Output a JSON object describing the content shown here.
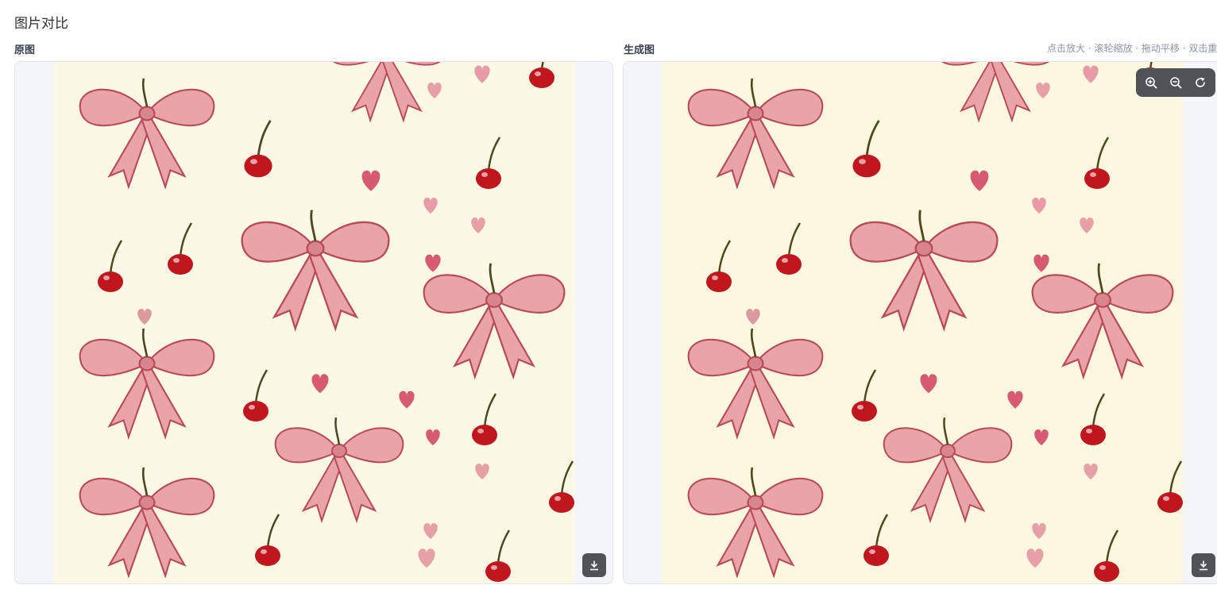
{
  "page": {
    "title": "图片对比"
  },
  "left_panel": {
    "label": "原图"
  },
  "right_panel": {
    "label": "生成图"
  },
  "hint": "点击放大 · 滚轮缩放 · 拖动平移 · 双击重置",
  "toolbar": {
    "icons": [
      "zoom-in-icon",
      "zoom-out-icon",
      "reset-icon"
    ]
  },
  "colors": {
    "panel_bg": "#f4f5f9",
    "toolbar_bg": "#4f5358",
    "bow_pink": "#e8a4a8",
    "bow_dark": "#b84a5a",
    "cherry_red": "#c0171e",
    "stem_green": "#4a4a20",
    "heart_pink": "#d65a72",
    "cream_left": "#fbf8e6",
    "cream_right": "#fcf8df"
  }
}
